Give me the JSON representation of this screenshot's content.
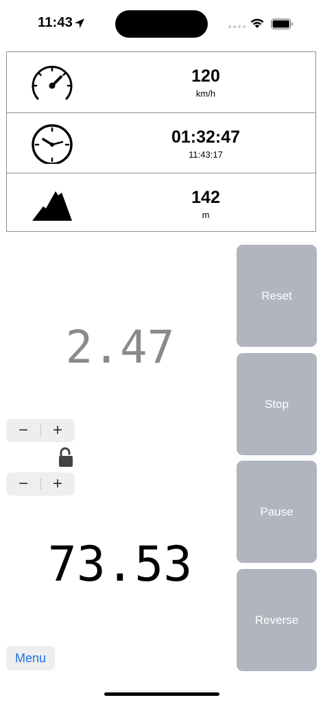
{
  "status_bar": {
    "time": "11:43",
    "location_icon": "location-arrow-icon",
    "wifi_icon": "wifi-icon",
    "battery_icon": "battery-icon"
  },
  "info_panel": {
    "speed": {
      "value": "120",
      "unit": "km/h",
      "icon": "speedometer-icon"
    },
    "time": {
      "value": "01:32:47",
      "sub": "11:43:17",
      "icon": "clock-icon"
    },
    "altitude": {
      "value": "142",
      "unit": "m",
      "icon": "mountain-icon"
    }
  },
  "display": {
    "upper_value": "2.47",
    "lower_value": "73.53",
    "upper_color": "#8a8a8a",
    "lower_color": "#000000"
  },
  "stepper_upper": {
    "minus": "−",
    "plus": "+"
  },
  "stepper_lower": {
    "minus": "−",
    "plus": "+"
  },
  "lock_icon": "unlocked-padlock-icon",
  "actions": {
    "reset": "Reset",
    "stop": "Stop",
    "pause": "Pause",
    "reverse": "Reverse"
  },
  "menu": {
    "label": "Menu"
  },
  "colors": {
    "button_bg": "#b0b5bf",
    "button_text": "#ffffff",
    "menu_text": "#1a73e8",
    "stepper_bg": "#eeeef0"
  }
}
